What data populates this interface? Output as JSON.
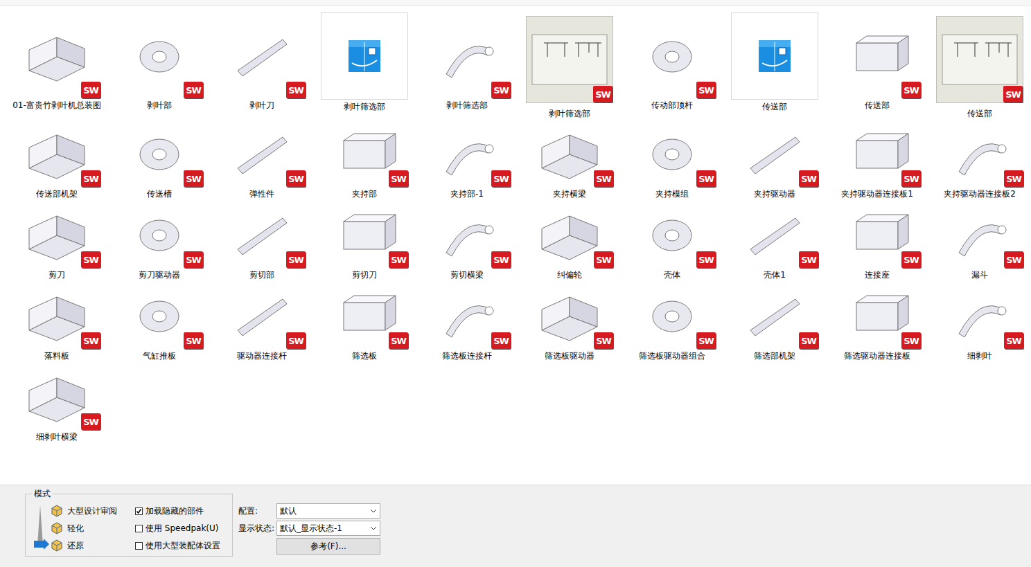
{
  "badge_text": "SW",
  "files": [
    {
      "name": "01-富贵竹剥叶机总装图",
      "kind": "part"
    },
    {
      "name": "剥叶部",
      "kind": "part"
    },
    {
      "name": "剥叶刀",
      "kind": "part"
    },
    {
      "name": "剥叶筛选部",
      "kind": "generic"
    },
    {
      "name": "剥叶筛选部",
      "kind": "part"
    },
    {
      "name": "剥叶筛选部",
      "kind": "drawing"
    },
    {
      "name": "传动部顶杆",
      "kind": "part"
    },
    {
      "name": "传送部",
      "kind": "generic"
    },
    {
      "name": "传送部",
      "kind": "part"
    },
    {
      "name": "传送部",
      "kind": "drawing"
    },
    {
      "name": "传送部机架",
      "kind": "part"
    },
    {
      "name": "传送槽",
      "kind": "part"
    },
    {
      "name": "弹性件",
      "kind": "part"
    },
    {
      "name": "夹持部",
      "kind": "part"
    },
    {
      "name": "夹持部-1",
      "kind": "part"
    },
    {
      "name": "夹持横梁",
      "kind": "part"
    },
    {
      "name": "夹持模组",
      "kind": "part"
    },
    {
      "name": "夹持驱动器",
      "kind": "part"
    },
    {
      "name": "夹持驱动器连接板1",
      "kind": "part"
    },
    {
      "name": "夹持驱动器连接板2",
      "kind": "part"
    },
    {
      "name": "剪刀",
      "kind": "part"
    },
    {
      "name": "剪刀驱动器",
      "kind": "part"
    },
    {
      "name": "剪切部",
      "kind": "part"
    },
    {
      "name": "剪切刀",
      "kind": "part"
    },
    {
      "name": "剪切横梁",
      "kind": "part"
    },
    {
      "name": "纠偏轮",
      "kind": "part"
    },
    {
      "name": "壳体",
      "kind": "part"
    },
    {
      "name": "壳体1",
      "kind": "part"
    },
    {
      "name": "连接座",
      "kind": "part"
    },
    {
      "name": "漏斗",
      "kind": "part"
    },
    {
      "name": "落料板",
      "kind": "part"
    },
    {
      "name": "气缸推板",
      "kind": "part"
    },
    {
      "name": "驱动器连接杆",
      "kind": "part"
    },
    {
      "name": "筛选板",
      "kind": "part"
    },
    {
      "name": "筛选板连接杆",
      "kind": "part"
    },
    {
      "name": "筛选板驱动器",
      "kind": "part"
    },
    {
      "name": "筛选板驱动器组合",
      "kind": "part"
    },
    {
      "name": "筛选部机架",
      "kind": "part"
    },
    {
      "name": "筛选驱动器连接板",
      "kind": "part"
    },
    {
      "name": "细剥叶",
      "kind": "part"
    },
    {
      "name": "细剥叶横梁",
      "kind": "part"
    }
  ],
  "panel": {
    "mode_title": "模式",
    "modes": [
      {
        "label": "大型设计审阅",
        "selected": false
      },
      {
        "label": "轻化",
        "selected": false
      },
      {
        "label": "还原",
        "selected": true
      }
    ],
    "checkboxes": [
      {
        "label": "加载隐藏的部件",
        "checked": true
      },
      {
        "label": "使用 Speedpak(U)",
        "checked": false
      },
      {
        "label": "使用大型装配体设置",
        "checked": false
      }
    ],
    "config_label": "配置:",
    "config_value": "默认",
    "display_label": "显示状态:",
    "display_value": "默认_显示状态-1",
    "reference_button": "参考(F)..."
  }
}
